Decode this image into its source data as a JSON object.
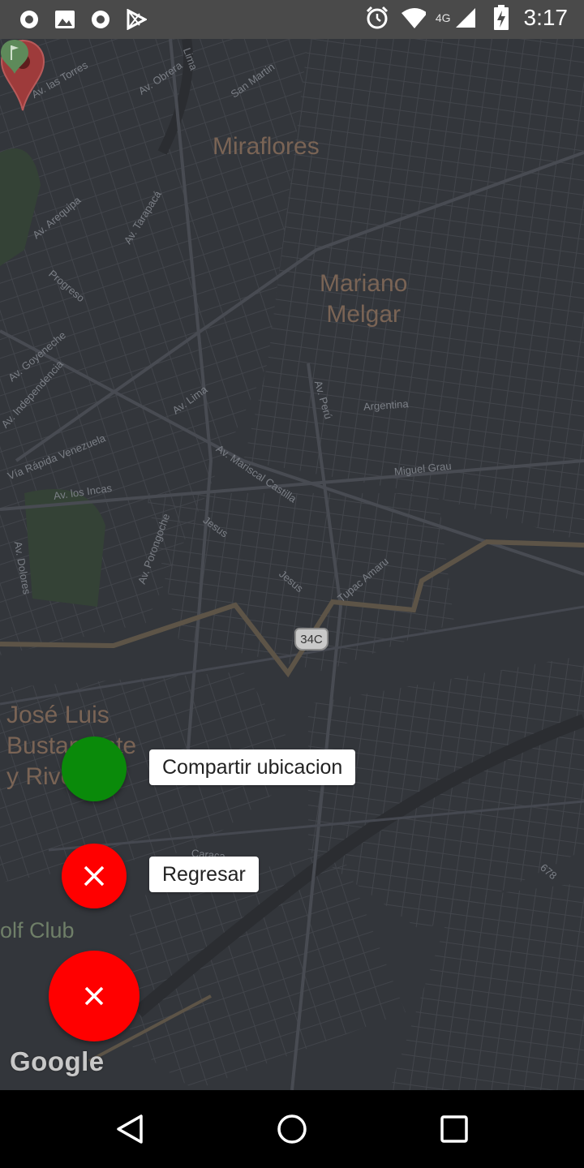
{
  "status_bar": {
    "time": "3:17",
    "network": "4G",
    "icons_left": [
      "circle-app-icon",
      "image-icon",
      "circle-app-icon",
      "play-store-icon"
    ],
    "icons_right": [
      "alarm-icon",
      "wifi-icon",
      "cell-signal-icon",
      "battery-charging-icon"
    ]
  },
  "map": {
    "places": [
      {
        "name": "Miraflores"
      },
      {
        "name": "Mariano\nMelgar"
      },
      {
        "name": "José Luis\nBustamante\ny Rivero"
      }
    ],
    "streets": [
      "Av. las Torres",
      "Av. Obrera",
      "Lima",
      "San Martin",
      "Av. Arequipa",
      "Av. Tarapacá",
      "Progreso",
      "Av. Goyeneche",
      "Av. Independencia",
      "Vía Rápida Venezuela",
      "Av. Lima",
      "Av. Perú",
      "Argentina",
      "Av. Mariscal Castilla",
      "Miguel Grau",
      "Av. los Incas",
      "Jesus",
      "Av. Porongoche",
      "Av. Dolores",
      "Tupac Amaru",
      "Jesus",
      "Caraca",
      "678"
    ],
    "route_shield": "34C",
    "golf_label": "olf Club",
    "attribution": "Google",
    "colors": {
      "background": "#33363b",
      "route": "#5d5447",
      "pin": "#9e3b3b"
    }
  },
  "actions": {
    "share_label": "Compartir ubicacion",
    "back_label": "Regresar",
    "colors": {
      "share": "#0a8a0a",
      "close": "#ff0000"
    }
  },
  "nav_bar": {
    "icons": [
      "back-icon",
      "home-icon",
      "recents-icon"
    ]
  }
}
